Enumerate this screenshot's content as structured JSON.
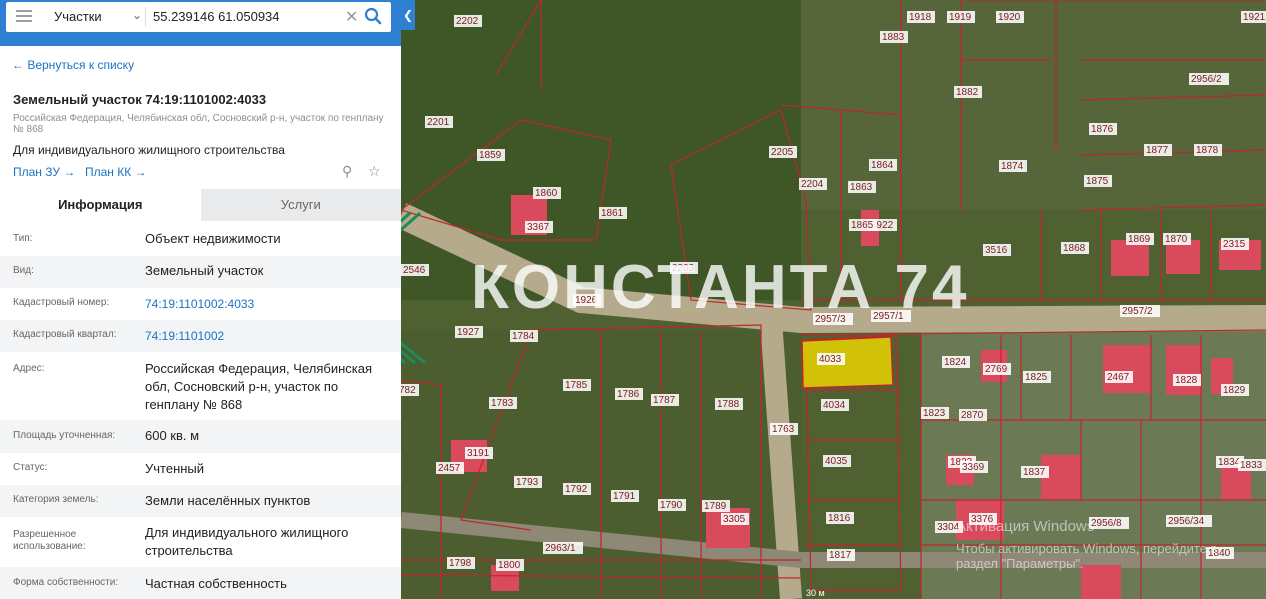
{
  "search": {
    "type_label": "Участки",
    "query": "55.239146 61.050934"
  },
  "nav": {
    "back": "← Вернуться к списку"
  },
  "parcel": {
    "title": "Земельный участок 74:19:1101002:4033",
    "address_short": "Российская Федерация, Челябинская обл, Сосновский р-н, участок по генплану № 868",
    "usage": "Для индивидуального жилищного строительства",
    "plan_zu": "План ЗУ →",
    "plan_kk": "План КК →"
  },
  "tabs": [
    {
      "label": "Информация",
      "active": true
    },
    {
      "label": "Услуги",
      "active": false
    }
  ],
  "info_rows": [
    {
      "label": "Тип:",
      "value": "Объект недвижимости"
    },
    {
      "label": "Вид:",
      "value": "Земельный участок"
    },
    {
      "label": "Кадастровый номер:",
      "value": "74:19:1101002:4033"
    },
    {
      "label": "Кадастровый квартал:",
      "value": "74:19:1101002"
    },
    {
      "label": "Адрес:",
      "value": "Российская Федерация, Челябинская обл, Сосновский р-н, участок по генплану № 868"
    },
    {
      "label": "Площадь уточненная:",
      "value": "600 кв. м"
    },
    {
      "label": "Статус:",
      "value": "Учтенный"
    },
    {
      "label": "Категория земель:",
      "value": "Земли населённых пунктов"
    },
    {
      "label": "Разрешенное использование:",
      "value": "Для индивидуального жилищного строительства"
    },
    {
      "label": "Форма собственности:",
      "value": "Частная собственность"
    }
  ],
  "map": {
    "watermark": "КОНСТАНТА 74",
    "windows_activation_title": "Активация Windows",
    "windows_activation_body": "Чтобы активировать Windows, перейдите в раздел \"Параметры\".",
    "scale_label": "30 м",
    "highlight_color": "#e8d400",
    "boundary_color": "#c0262c",
    "plot_labels": [
      {
        "text": "2202"
      },
      {
        "text": "1883"
      },
      {
        "text": "1918"
      },
      {
        "text": "1919"
      },
      {
        "text": "1920"
      },
      {
        "text": "1921"
      },
      {
        "text": "2201"
      },
      {
        "text": "1882"
      },
      {
        "text": "2956/2"
      },
      {
        "text": "1876"
      },
      {
        "text": "1859"
      },
      {
        "text": "2205"
      },
      {
        "text": "1864"
      },
      {
        "text": "1877"
      },
      {
        "text": "1878"
      },
      {
        "text": "1874"
      },
      {
        "text": "1875"
      },
      {
        "text": "1860"
      },
      {
        "text": "2204"
      },
      {
        "text": "1863"
      },
      {
        "text": "3922"
      },
      {
        "text": "1861"
      },
      {
        "text": "1865"
      },
      {
        "text": "3367"
      },
      {
        "text": "2203"
      },
      {
        "text": "3516"
      },
      {
        "text": "1868"
      },
      {
        "text": "1869"
      },
      {
        "text": "1870"
      },
      {
        "text": "2315"
      },
      {
        "text": "2546"
      },
      {
        "text": "1926"
      },
      {
        "text": "2957/3"
      },
      {
        "text": "2957/1"
      },
      {
        "text": "2957/2"
      },
      {
        "text": "1927"
      },
      {
        "text": "1784"
      },
      {
        "text": "4033"
      },
      {
        "text": "1824"
      },
      {
        "text": "2769"
      },
      {
        "text": "1825"
      },
      {
        "text": "2467"
      },
      {
        "text": "1828"
      },
      {
        "text": "1829"
      },
      {
        "text": "1785"
      },
      {
        "text": "1786"
      },
      {
        "text": "1787"
      },
      {
        "text": "1788"
      },
      {
        "text": "4034"
      },
      {
        "text": "1823"
      },
      {
        "text": "2870"
      },
      {
        "text": "1783"
      },
      {
        "text": "1763"
      },
      {
        "text": "4035"
      },
      {
        "text": "1822"
      },
      {
        "text": "2457"
      },
      {
        "text": "3191"
      },
      {
        "text": "1793"
      },
      {
        "text": "1792"
      },
      {
        "text": "1791"
      },
      {
        "text": "1790"
      },
      {
        "text": "1789"
      },
      {
        "text": "1816"
      },
      {
        "text": "3369"
      },
      {
        "text": "1834"
      },
      {
        "text": "1833"
      },
      {
        "text": "1837"
      },
      {
        "text": "3305"
      },
      {
        "text": "3304"
      },
      {
        "text": "2956/8"
      },
      {
        "text": "2956/34"
      },
      {
        "text": "2963/1"
      },
      {
        "text": "1798"
      },
      {
        "text": "1800"
      },
      {
        "text": "1817"
      },
      {
        "text": "1840"
      },
      {
        "text": "782"
      },
      {
        "text": "3376"
      }
    ]
  }
}
